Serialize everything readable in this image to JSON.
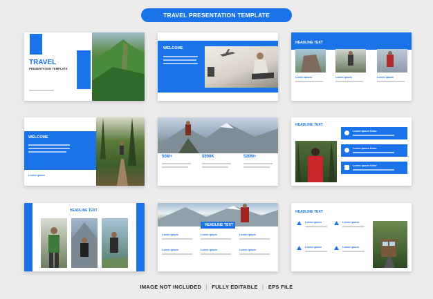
{
  "banner": "TRAVEL PRESENTATION TEMPLATE",
  "slide1": {
    "title": "TRAVEL",
    "subtitle": "PRESENTATION TEMPLATE"
  },
  "slide2": {
    "heading": "WELCOME"
  },
  "slide3": {
    "heading": "HEADLINE TEXT",
    "caption": "Lorem ipsum"
  },
  "slide4": {
    "heading": "WELCOME",
    "caption": "Lorem ipsum"
  },
  "slide5": {
    "stats": [
      "50M+",
      "$500K",
      "520M+"
    ]
  },
  "slide6": {
    "heading": "HEADLINE TEXT",
    "item": "Lorem Ipsum Dolor"
  },
  "slide7": {
    "heading": "HEADLINE TEXT"
  },
  "slide8": {
    "heading": "HEADLINE TEXT",
    "caption": "Lorem ipsum"
  },
  "slide9": {
    "heading": "HEADLINE TEXT",
    "caption": "Lorem ipsum"
  },
  "footer": {
    "a": "IMAGE NOT INCLUDED",
    "b": "FULLY EDITABLE",
    "c": "EPS FILE",
    "sep": "|"
  },
  "colors": {
    "accent": "#1a73e8",
    "background": "#ececec"
  }
}
